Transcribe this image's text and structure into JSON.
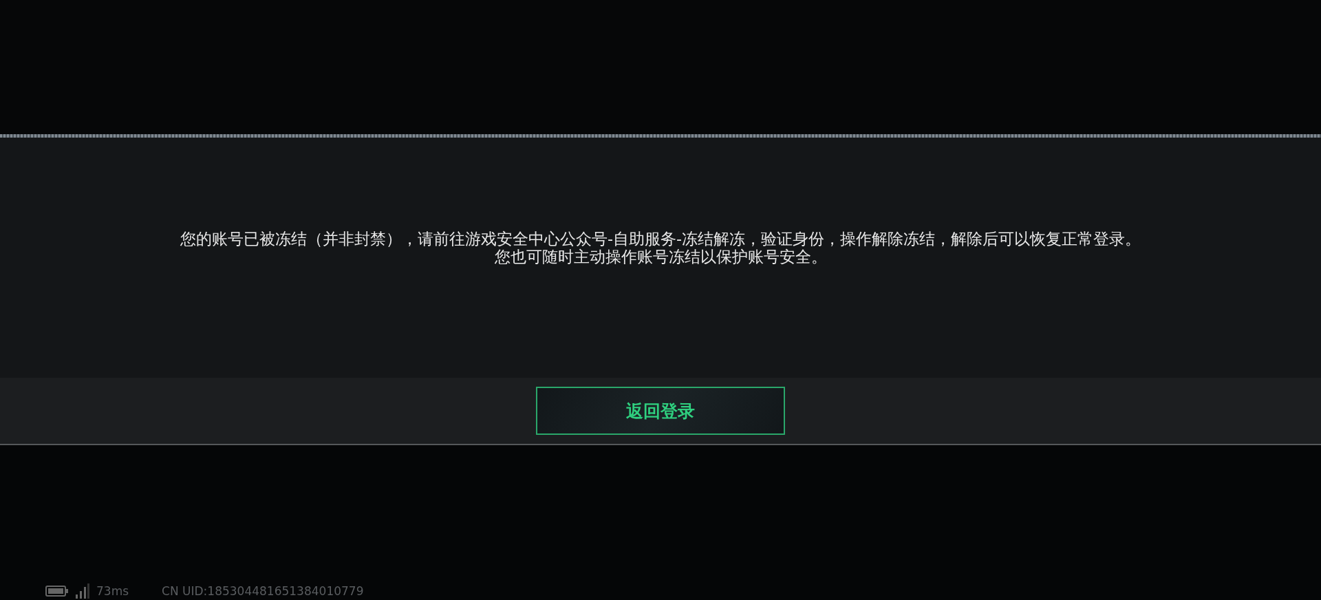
{
  "dialog": {
    "message_lines": [
      "您的账号已被冻结（并非封禁），请前往游戏安全中心公众号-自助服务-冻结解冻，验证身份，操作解除冻结，解除后可以恢复正常登录。",
      "您也可随时主动操作账号冻结以保护账号安全。"
    ],
    "buttons": [
      {
        "kind": "primary",
        "label": "返回登录"
      }
    ]
  },
  "status_bar": {
    "ping": "73ms",
    "uid": "CN UID:185304481651384010779"
  }
}
